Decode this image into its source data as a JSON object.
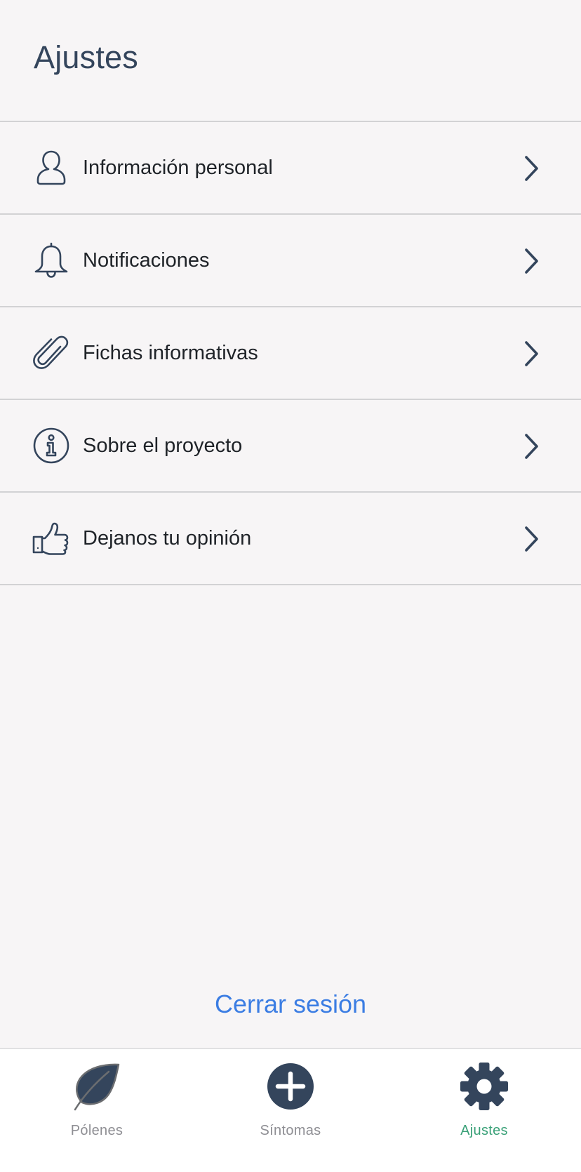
{
  "header": {
    "title": "Ajustes"
  },
  "menu": [
    {
      "label": "Información personal",
      "icon": "user-icon"
    },
    {
      "label": "Notificaciones",
      "icon": "bell-icon"
    },
    {
      "label": "Fichas informativas",
      "icon": "paperclip-icon"
    },
    {
      "label": "Sobre el proyecto",
      "icon": "info-icon"
    },
    {
      "label": "Dejanos tu opinión",
      "icon": "thumbs-up-icon"
    }
  ],
  "logout": {
    "label": "Cerrar sesión"
  },
  "tabbar": {
    "tabs": [
      {
        "label": "Pólenes",
        "icon": "leaf-icon",
        "active": false
      },
      {
        "label": "Síntomas",
        "icon": "plus-circle-icon",
        "active": false
      },
      {
        "label": "Ajustes",
        "icon": "gear-icon",
        "active": true
      }
    ]
  },
  "colors": {
    "accent": "#3aa178",
    "link": "#3b7de3",
    "icon": "#34455c",
    "background": "#f7f5f6"
  }
}
